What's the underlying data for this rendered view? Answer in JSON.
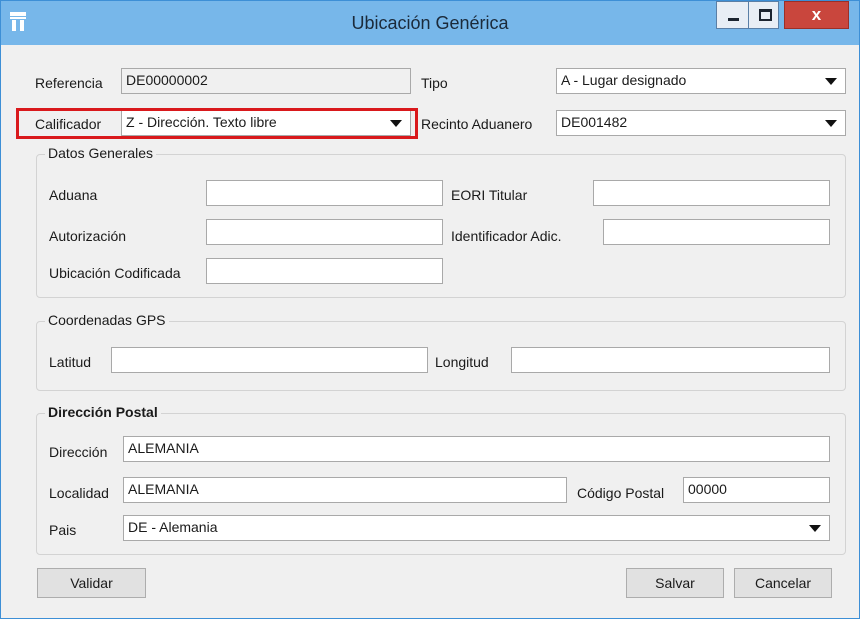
{
  "window": {
    "title": "Ubicación Genérica",
    "minimize_label": "—",
    "maximize_label": "☐",
    "close_label": "x"
  },
  "header": {
    "referencia": {
      "label": "Referencia",
      "value": "DE00000002"
    },
    "tipo": {
      "label": "Tipo",
      "value": "A - Lugar designado"
    },
    "calificador": {
      "label": "Calificador",
      "value": "Z - Dirección. Texto libre"
    },
    "recinto": {
      "label": "Recinto Aduanero",
      "value": "DE001482"
    }
  },
  "datos_generales": {
    "legend": "Datos Generales",
    "aduana": {
      "label": "Aduana",
      "value": ""
    },
    "eori": {
      "label": "EORI Titular",
      "value": ""
    },
    "autorizacion": {
      "label": "Autorización",
      "value": ""
    },
    "identificador": {
      "label": "Identificador Adic.",
      "value": ""
    },
    "ubicacion": {
      "label": "Ubicación Codificada",
      "value": ""
    }
  },
  "gps": {
    "legend": "Coordenadas GPS",
    "latitud": {
      "label": "Latitud",
      "value": ""
    },
    "longitud": {
      "label": "Longitud",
      "value": ""
    }
  },
  "postal": {
    "legend": "Dirección Postal",
    "direccion": {
      "label": "Dirección",
      "value": "ALEMANIA"
    },
    "localidad": {
      "label": "Localidad",
      "value": "ALEMANIA"
    },
    "codigo": {
      "label": "Código Postal",
      "value": "00000"
    },
    "pais": {
      "label": "Pais",
      "value": "DE - Alemania"
    }
  },
  "buttons": {
    "validar": "Validar",
    "salvar": "Salvar",
    "cancelar": "Cancelar"
  },
  "colors": {
    "titlebar": "#77b7ea",
    "close": "#c9463d",
    "highlight": "#d9191c"
  }
}
